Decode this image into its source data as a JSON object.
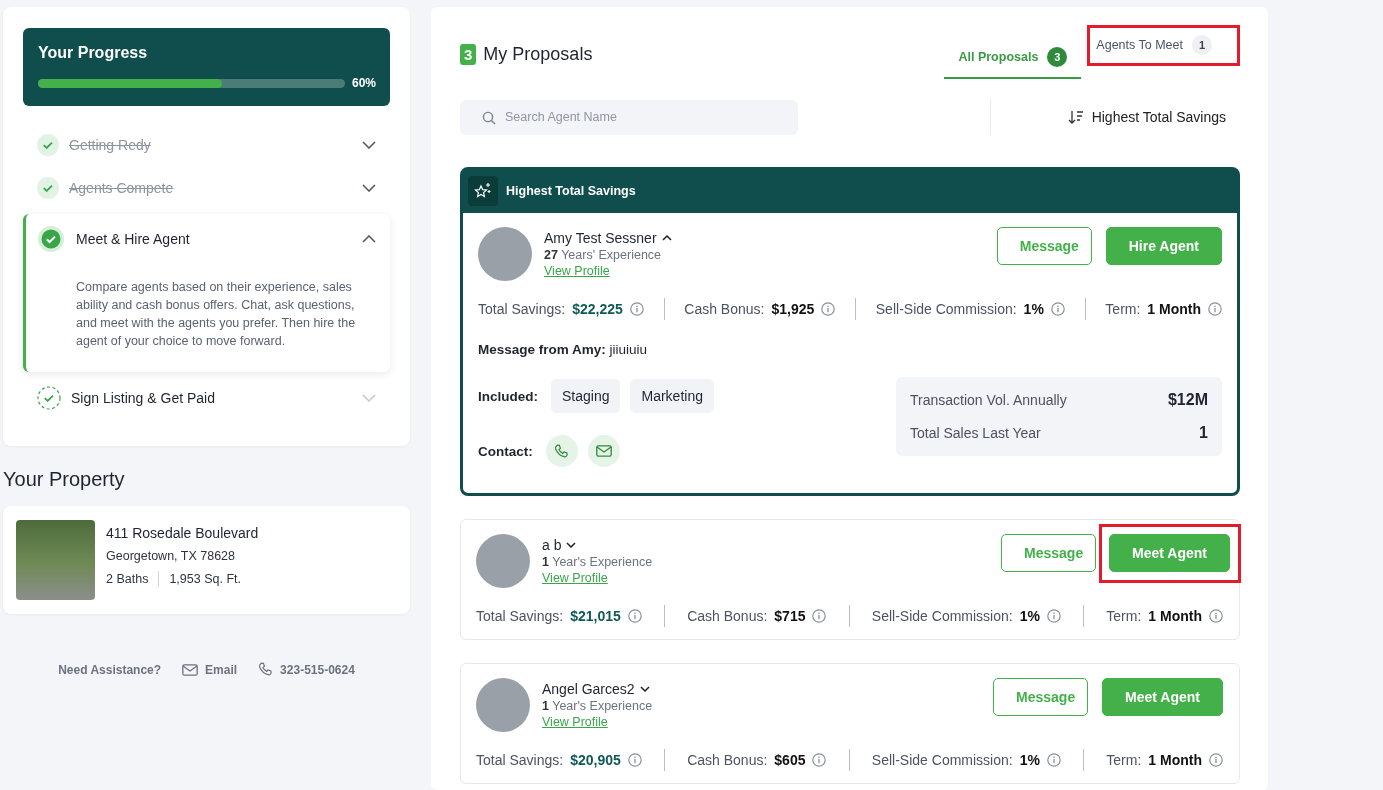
{
  "progress": {
    "title": "Your Progress",
    "level": 0.6,
    "percent": "60%"
  },
  "steps": [
    {
      "label": "Getting Redy",
      "completed": true,
      "current": false,
      "expanded": false
    },
    {
      "label": "Agents Compete",
      "completed": true,
      "current": false,
      "expanded": false
    },
    {
      "label": "Meet & Hire Agent",
      "completed": false,
      "current": true,
      "expanded": true,
      "description": "Compare agents based on their experience, sales ability and cash bonus offers. Chat, ask questions, and meet with the agents you prefer. Then hire the agent of your choice to move forward."
    },
    {
      "label": "Sign Listing & Get Paid",
      "completed": false,
      "current": false,
      "expanded": false
    }
  ],
  "property": {
    "heading": "Your Property",
    "address": "411 Rosedale Boulevard",
    "city": "Georgetown, TX 78628",
    "baths": "2 Baths",
    "area": "1,953 Sq. Ft."
  },
  "assistance": {
    "label": "Need Assistance?",
    "email": "Email",
    "phone": "323-515-0624"
  },
  "proposals": {
    "count": "3",
    "title": "My Proposals",
    "tabs": [
      {
        "label": "All Proposals",
        "count": "3",
        "selected": true,
        "highlighted": false
      },
      {
        "label": "Agents To Meet",
        "count": "1",
        "selected": false,
        "highlighted": true
      }
    ],
    "search": {
      "placeholder": "Search Agent Name"
    },
    "sort": "Highest Total Savings"
  },
  "agents": [
    {
      "featured_label": "Highest Total Savings",
      "name": "Amy Test Sessner",
      "expanded": true,
      "experience": "**27** Years' Experience",
      "view_profile": "View Profile",
      "buttons": [
        {
          "label": "Message",
          "kind": "outline",
          "highlighted": false
        },
        {
          "label": "Hire Agent",
          "kind": "primary",
          "highlighted": false
        }
      ],
      "stats": [
        {
          "label": "Total Savings:",
          "value": "$22,225",
          "kind": "savings"
        },
        {
          "label": "Cash Bonus:",
          "value": "$1,925",
          "kind": "plain"
        },
        {
          "label": "Sell-Side Commission:",
          "value": "1%",
          "kind": "plain"
        },
        {
          "label": "Term:",
          "value": "1 Month",
          "kind": "plain"
        }
      ],
      "message": "**Message from Amy:** jiiuiuiu",
      "included_label": "Included:",
      "included": [
        "Staging",
        "Marketing"
      ],
      "contact_label": "Contact:",
      "facts": [
        {
          "label": "Transaction Vol. Annually",
          "value": "$12M"
        },
        {
          "label": "Total Sales Last Year",
          "value": "1"
        }
      ]
    },
    {
      "name": "a b",
      "expanded": false,
      "experience": "**1** Year's Experience",
      "view_profile": "View Profile",
      "buttons": [
        {
          "label": "Message",
          "kind": "outline",
          "highlighted": false
        },
        {
          "label": "Meet Agent",
          "kind": "primary",
          "highlighted": true
        }
      ],
      "stats": [
        {
          "label": "Total Savings:",
          "value": "$21,015",
          "kind": "savings"
        },
        {
          "label": "Cash Bonus:",
          "value": "$715",
          "kind": "plain"
        },
        {
          "label": "Sell-Side Commission:",
          "value": "1%",
          "kind": "plain"
        },
        {
          "label": "Term:",
          "value": "1 Month",
          "kind": "plain"
        }
      ]
    },
    {
      "name": "Angel Garces2",
      "expanded": false,
      "experience": "**1** Year's Experience",
      "view_profile": "View Profile",
      "buttons": [
        {
          "label": "Message",
          "kind": "outline",
          "highlighted": false
        },
        {
          "label": "Meet Agent",
          "kind": "primary",
          "highlighted": false
        }
      ],
      "stats": [
        {
          "label": "Total Savings:",
          "value": "$20,905",
          "kind": "savings"
        },
        {
          "label": "Cash Bonus:",
          "value": "$605",
          "kind": "plain"
        },
        {
          "label": "Sell-Side Commission:",
          "value": "1%",
          "kind": "plain"
        },
        {
          "label": "Term:",
          "value": "1 Month",
          "kind": "plain"
        }
      ]
    }
  ]
}
